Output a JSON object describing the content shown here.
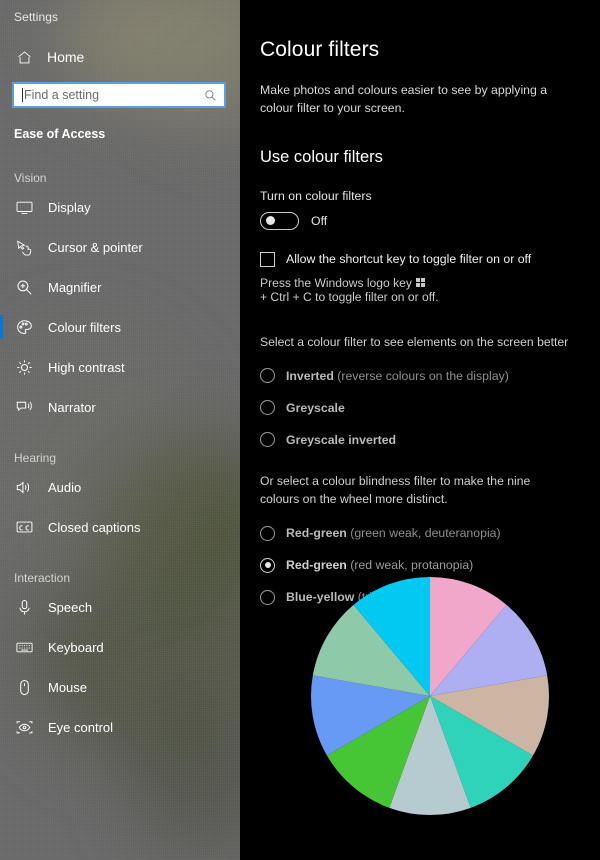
{
  "sidebar": {
    "app_title": "Settings",
    "home": {
      "label": "Home",
      "icon": "home-icon"
    },
    "search": {
      "placeholder": "Find a setting",
      "icon": "search-icon",
      "value": ""
    },
    "category": "Ease of Access",
    "groups": [
      {
        "header": "Vision",
        "items": [
          {
            "label": "Display",
            "icon": "monitor-icon",
            "selected": false
          },
          {
            "label": "Cursor & pointer",
            "icon": "cursor-pointer-icon",
            "selected": false
          },
          {
            "label": "Magnifier",
            "icon": "magnifier-icon",
            "selected": false
          },
          {
            "label": "Colour filters",
            "icon": "palette-icon",
            "selected": true
          },
          {
            "label": "High contrast",
            "icon": "sun-contrast-icon",
            "selected": false
          },
          {
            "label": "Narrator",
            "icon": "narrator-icon",
            "selected": false
          }
        ]
      },
      {
        "header": "Hearing",
        "items": [
          {
            "label": "Audio",
            "icon": "speaker-icon",
            "selected": false
          },
          {
            "label": "Closed captions",
            "icon": "closed-captions-icon",
            "selected": false
          }
        ]
      },
      {
        "header": "Interaction",
        "items": [
          {
            "label": "Speech",
            "icon": "microphone-icon",
            "selected": false
          },
          {
            "label": "Keyboard",
            "icon": "keyboard-icon",
            "selected": false
          },
          {
            "label": "Mouse",
            "icon": "mouse-icon",
            "selected": false
          },
          {
            "label": "Eye control",
            "icon": "eye-control-icon",
            "selected": false
          }
        ]
      }
    ],
    "accent_color": "#0b76d4",
    "background_color": "#646464"
  },
  "main": {
    "page_title": "Colour filters",
    "page_description": "Make photos and colours easier to see by applying a colour filter to your screen.",
    "section_title": "Use colour filters",
    "toggle": {
      "label": "Turn on colour filters",
      "state_label": "Off",
      "checked": false
    },
    "shortcut_checkbox": {
      "label": "Allow the shortcut key to toggle filter on or off",
      "checked": false
    },
    "shortcut_hint_before": "Press the Windows logo key",
    "shortcut_hint_after": "+ Ctrl + C to toggle filter on or off.",
    "filter_prompt": "Select a colour filter to see elements on the screen better",
    "filter_options": [
      {
        "name": "Inverted",
        "detail": " (reverse colours on the display)",
        "checked": false
      },
      {
        "name": "Greyscale",
        "detail": "",
        "checked": false
      },
      {
        "name": "Greyscale inverted",
        "detail": "",
        "checked": false
      }
    ],
    "blindness_prompt": "Or select a colour blindness filter to make the nine colours on the wheel more distinct.",
    "blindness_options": [
      {
        "name": "Red-green",
        "detail": " (green weak, deuteranopia)",
        "checked": false
      },
      {
        "name": "Red-green",
        "detail": " (red weak, protanopia)",
        "checked": true
      },
      {
        "name": "Blue-yellow",
        "detail": " (tritanopia)",
        "checked": false
      }
    ],
    "colour_wheel": {
      "name": "colour-wheel",
      "segments": [
        {
          "label": "pink",
          "color": "#f0a7c8"
        },
        {
          "label": "periwinkle",
          "color": "#aeaef2"
        },
        {
          "label": "tan",
          "color": "#cdb5a4"
        },
        {
          "label": "teal",
          "color": "#2ed3ba"
        },
        {
          "label": "pale-blue",
          "color": "#b5cbd0"
        },
        {
          "label": "green",
          "color": "#46c634"
        },
        {
          "label": "blue",
          "color": "#669af5"
        },
        {
          "label": "sage",
          "color": "#8ecaa9"
        },
        {
          "label": "cyan",
          "color": "#00c9f2"
        }
      ]
    }
  }
}
